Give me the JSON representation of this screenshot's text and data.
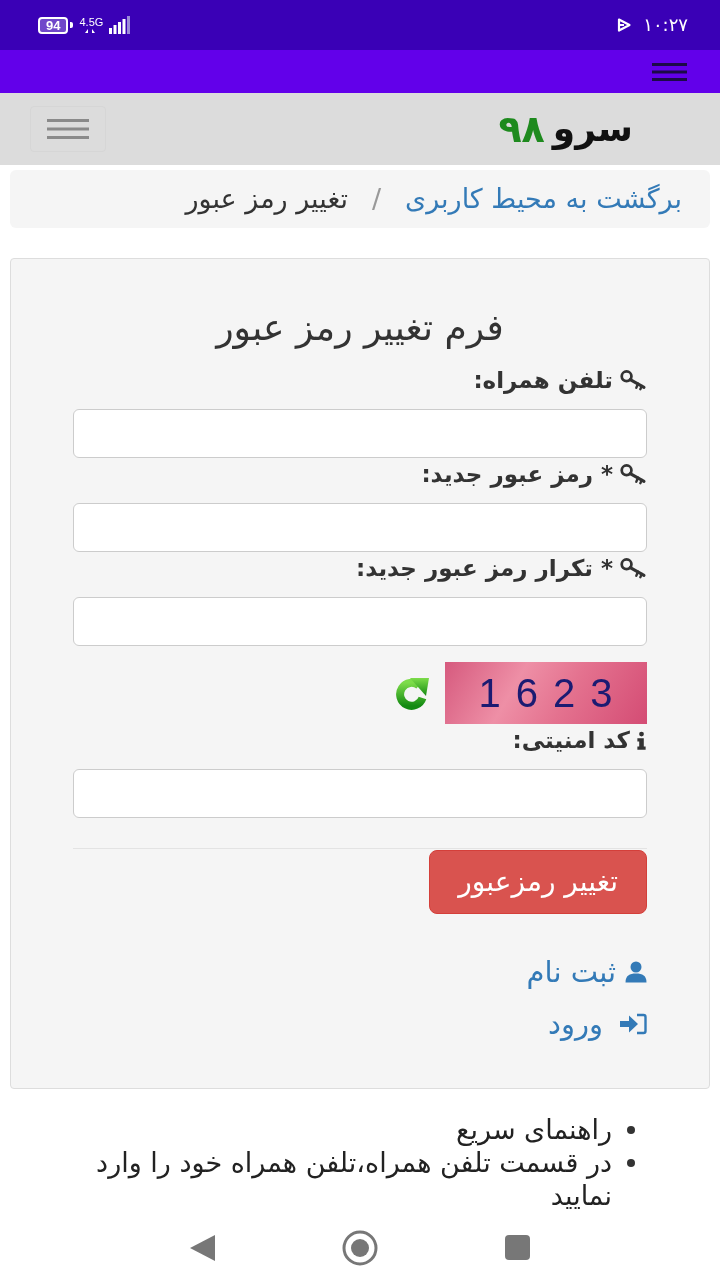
{
  "status_bar": {
    "time": "۱۰:۲۷",
    "battery": "94",
    "network": "4.5G"
  },
  "site_header": {
    "logo": {
      "word": "سرو",
      "number": "۹۸"
    }
  },
  "breadcrumb": {
    "separator": "/",
    "items": [
      {
        "kind": "link",
        "label": "برگشت به محیط کاربری"
      },
      {
        "kind": "current",
        "label": "تغییر رمز عبور"
      }
    ]
  },
  "form": {
    "title": "فرم تغییر رمز عبور",
    "fields": [
      {
        "kind": "standard",
        "label": "تلفن همراه:"
      },
      {
        "kind": "standard",
        "label": "* رمز عبور جدید:"
      },
      {
        "kind": "standard",
        "label": "* تکرار رمز عبور جدید:"
      },
      {
        "kind": "captcha",
        "label": "کد امنیتی:",
        "captcha_code": "1623"
      }
    ],
    "submit": "تغییر رمزعبور",
    "links": [
      {
        "kind": "register",
        "label": "ثبت نام"
      },
      {
        "kind": "login",
        "label": "ورود"
      }
    ]
  },
  "help": {
    "items": [
      "راهنمای سریع",
      "در قسمت تلفن همراه،تلفن همراه خود را وارد نمایید"
    ]
  }
}
